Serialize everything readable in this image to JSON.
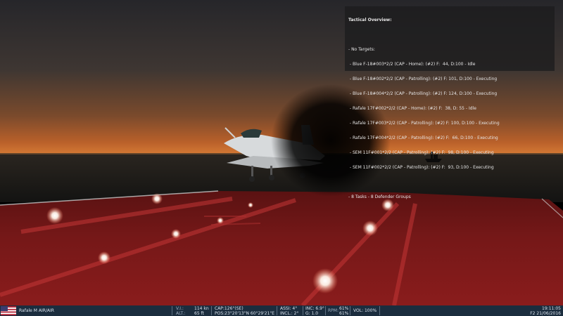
{
  "overlay": {
    "title": "Tactical Overview:",
    "no_targets": "- No Targets:",
    "tasks": [
      " - Blue F-18#003*2/2 (CAP - Home): (#2) F:  44, D:100 - Idle",
      " - Blue F-18#002*2/2 (CAP - Patrolling): (#2) F: 101, D:100 - Executing",
      " - Blue F-18#004*2/2 (CAP - Patrolling): (#2) F: 124, D:100 - Executing",
      " - Rafale 17F#002*2/2 (CAP - Home): (#2) F:  38, D: 55 - Idle",
      " - Rafale 17F#003*2/2 (CAP - Patrolling): (#2) F: 100, D:100 - Executing",
      " - Rafale 17F#004*2/2 (CAP - Patrolling): (#2) F:  66, D:100 - Executing",
      " - SEM 11F#001*2/2 (CAP - Patrolling): (#2) F:  98, D:100 - Executing",
      " - SEM 11F#002*2/2 (CAP - Patrolling): (#2) F:  93, D:100 - Executing"
    ],
    "summary": "- 8 Tasks - 8 Defender Groups"
  },
  "statusbar": {
    "aircraft": "Rafale  M AIR/AIR",
    "vi_label": "V.I.:",
    "vi_value": "114 kn",
    "alt_label": "ALT.:",
    "alt_value": "65 ft",
    "cap": "CAP:126°(SE)",
    "pos": "POS:23°20'13\"N 60°29'21\"E",
    "assi": "ASSI: 4°",
    "incl": "INCL.: 2°",
    "inc": "INC: 6.9°",
    "g": "G: 1.0",
    "rpm_label": "RPM:",
    "rpm1": "61%",
    "rpm2": "61%",
    "vol": "VOL: 100%",
    "time": "19:11:05",
    "date": "F2 21/06/2016"
  },
  "colors": {
    "statusbar_bg": "#1b2d3e",
    "overlay_bg": "#1c1c1e",
    "deck_red": "#7a1616",
    "sky_orange": "#c4622a",
    "sea": "#1a1a18"
  },
  "icons": {
    "flag": "us-flag-icon"
  }
}
